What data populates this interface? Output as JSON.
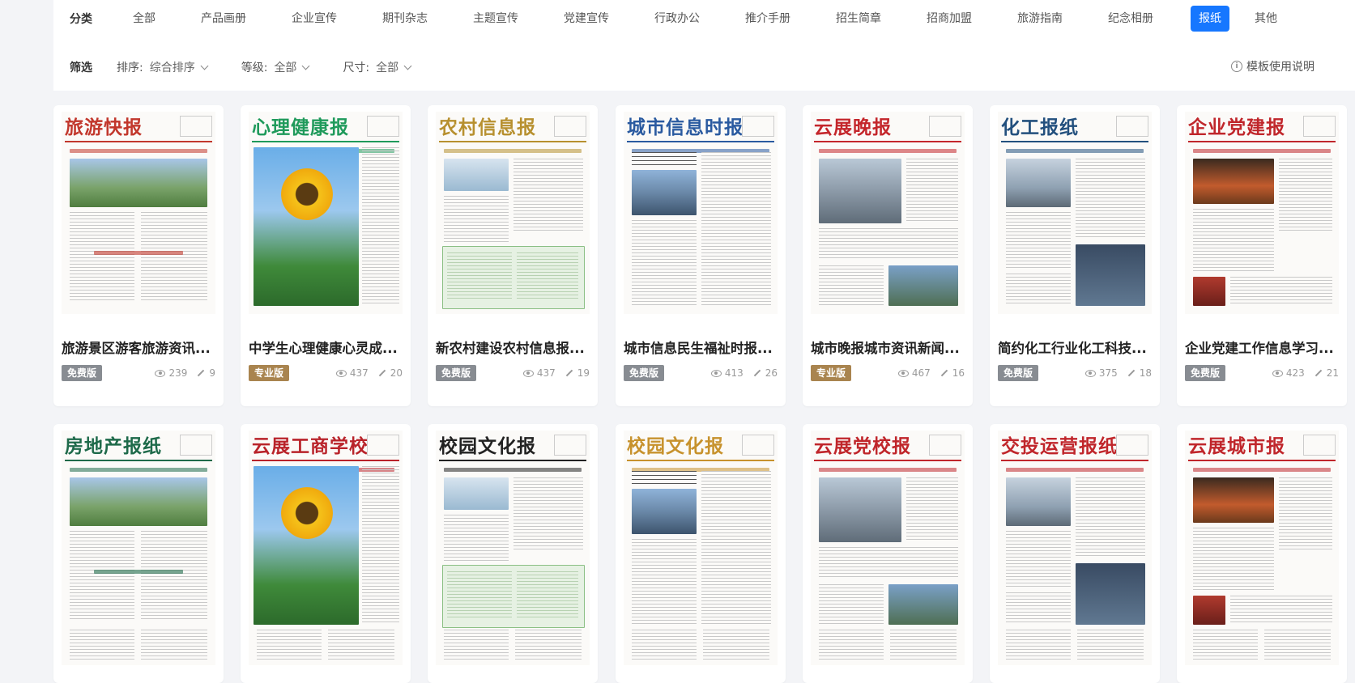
{
  "categories": {
    "heading": "分类",
    "items": [
      "全部",
      "产品画册",
      "企业宣传",
      "期刊杂志",
      "主题宣传",
      "党建宣传",
      "行政办公",
      "推介手册",
      "招生简章",
      "招商加盟",
      "旅游指南",
      "纪念相册",
      "报纸",
      "其他"
    ],
    "active": "报纸"
  },
  "filters": {
    "heading": "筛选",
    "sort_label": "排序:",
    "sort_value": "综合排序",
    "level_label": "等级:",
    "level_value": "全部",
    "size_label": "尺寸:",
    "size_value": "全部",
    "help": "模板使用说明"
  },
  "cards": [
    {
      "title": "旅游景区游客旅游资讯...",
      "badge": "免费版",
      "tier": "free",
      "views": "239",
      "uses": "9",
      "mast": "旅游快报",
      "mast_color": "#c2372c"
    },
    {
      "title": "中学生心理健康心灵成...",
      "badge": "专业版",
      "tier": "pro",
      "views": "437",
      "uses": "20",
      "mast": "心理健康报",
      "mast_color": "#1f9a5b"
    },
    {
      "title": "新农村建设农村信息报...",
      "badge": "免费版",
      "tier": "free",
      "views": "437",
      "uses": "19",
      "mast": "农村信息报",
      "mast_color": "#b7902f"
    },
    {
      "title": "城市信息民生福祉时报...",
      "badge": "免费版",
      "tier": "free",
      "views": "413",
      "uses": "26",
      "mast": "城市信息时报",
      "mast_color": "#2a5aa0"
    },
    {
      "title": "城市晚报城市资讯新闻...",
      "badge": "专业版",
      "tier": "pro",
      "views": "467",
      "uses": "16",
      "mast": "云展晚报",
      "mast_color": "#c4262b"
    },
    {
      "title": "简约化工行业化工科技...",
      "badge": "免费版",
      "tier": "free",
      "views": "375",
      "uses": "18",
      "mast": "化工报纸",
      "mast_color": "#23507e"
    },
    {
      "title": "企业党建工作信息学习...",
      "badge": "免费版",
      "tier": "free",
      "views": "423",
      "uses": "21",
      "mast": "企业党建报",
      "mast_color": "#c0262b"
    },
    {
      "title": "",
      "badge": "",
      "tier": "",
      "views": "",
      "uses": "",
      "mast": "房地产报纸",
      "mast_color": "#1e6a4a"
    },
    {
      "title": "",
      "badge": "",
      "tier": "",
      "views": "",
      "uses": "",
      "mast": "云展工商学校",
      "mast_color": "#b9232a"
    },
    {
      "title": "",
      "badge": "",
      "tier": "",
      "views": "",
      "uses": "",
      "mast": "校园文化报",
      "mast_color": "#222222"
    },
    {
      "title": "",
      "badge": "",
      "tier": "",
      "views": "",
      "uses": "",
      "mast": "校园文化报",
      "mast_color": "#c7922d"
    },
    {
      "title": "",
      "badge": "",
      "tier": "",
      "views": "",
      "uses": "",
      "mast": "云展党校报",
      "mast_color": "#c0262b"
    },
    {
      "title": "",
      "badge": "",
      "tier": "",
      "views": "",
      "uses": "",
      "mast": "交投运营报纸",
      "mast_color": "#c0262b"
    },
    {
      "title": "",
      "badge": "",
      "tier": "",
      "views": "",
      "uses": "",
      "mast": "云展城市报",
      "mast_color": "#c0262b"
    }
  ]
}
